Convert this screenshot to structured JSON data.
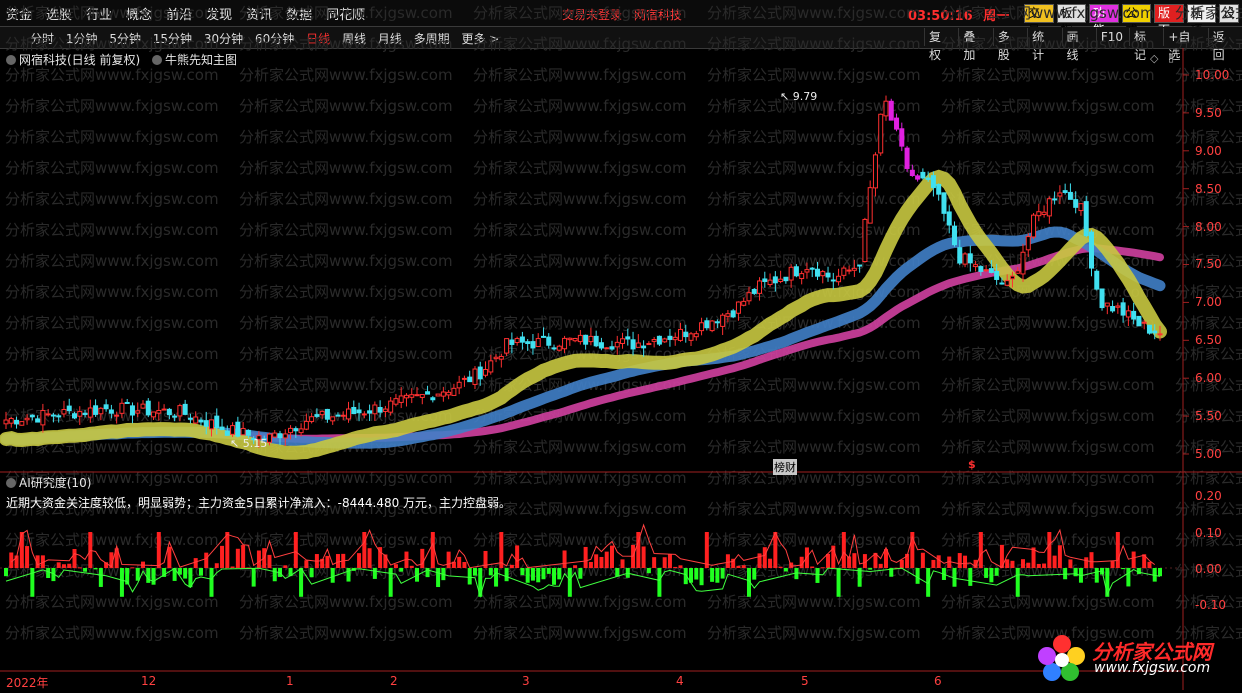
{
  "menu": [
    "资金",
    "选股",
    "行业",
    "概念",
    "前沿",
    "发现",
    "资讯",
    "数据",
    "同花顺"
  ],
  "notice": {
    "login": "交易未登录",
    "stock": "网宿科技"
  },
  "clock": {
    "time": "03:50:16",
    "weekday": "周一"
  },
  "top_buttons": [
    {
      "label": "交易",
      "bg": "#f0c020",
      "fg": "#000000"
    },
    {
      "label": "板指",
      "bg": "#e0e0e0",
      "fg": "#000000"
    },
    {
      "label": "功能",
      "bg": "#e030e0",
      "fg": "#ffffff"
    },
    {
      "label": "公式",
      "bg": "#f0d000",
      "fg": "#000000"
    },
    {
      "label": "版面",
      "bg": "#e02020",
      "fg": "#ffffff"
    },
    {
      "label": "选项",
      "bg": "#f0f0f0",
      "fg": "#000000"
    },
    {
      "label": "设",
      "bg": "#e0e0e0",
      "fg": "#000000"
    }
  ],
  "periods": [
    "分时",
    "1分钟",
    "5分钟",
    "15分钟",
    "30分钟",
    "60分钟",
    "日线",
    "周线",
    "月线",
    "多周期",
    "更多 >"
  ],
  "selected_period": "日线",
  "tools": [
    "复权",
    "叠加",
    "多股",
    "统计",
    "画线",
    "F10",
    "标记",
    "+自选",
    "返回"
  ],
  "chart_title": "网宿科技(日线 前复权)",
  "indicator_name": "牛熊先知主图",
  "price_axis": [
    "10.00",
    "9.50",
    "9.00",
    "8.50",
    "8.00",
    "7.50",
    "7.00",
    "6.50",
    "6.00",
    "5.50",
    "5.00"
  ],
  "high_label": "9.79",
  "low_label": "5.15",
  "event_label": "榜财",
  "event_mark": "$",
  "sub_title": "AI研究度(10)",
  "sub_summary": "近期大资金关注度较低，明显弱势；主力资金5日累计净流入：-8444.480 万元，主力控盘弱。",
  "sub_axis": [
    "0.20",
    "0.10",
    "0.00",
    "-0.10"
  ],
  "date_labels": [
    {
      "label": "2022年"
    },
    {
      "label": "12"
    },
    {
      "label": "1"
    },
    {
      "label": "2"
    },
    {
      "label": "3"
    },
    {
      "label": "4"
    },
    {
      "label": "5"
    },
    {
      "label": "6"
    }
  ],
  "watermark": "分析家公式网www.fxjgsw.com",
  "logo": {
    "title": "分析家公式网",
    "url": "www.fxjgsw.com"
  },
  "colors": {
    "up": "#ff3030",
    "down": "#40e0f0",
    "band1": "#c8c840",
    "band2": "#4080c8",
    "band3": "#d040a0",
    "bar_pos": "#ff2020",
    "bar_neg": "#20ff20"
  }
}
